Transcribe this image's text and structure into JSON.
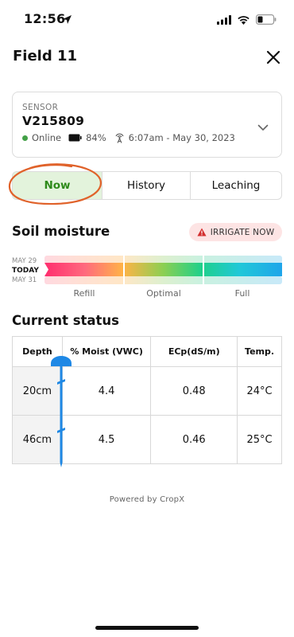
{
  "status_bar": {
    "time": "12:56"
  },
  "header": {
    "title": "Field 11"
  },
  "sensor": {
    "label": "SENSOR",
    "id": "V215809",
    "status": "Online",
    "status_color": "#43a047",
    "battery": "84%",
    "last_seen": "6:07am - May 30, 2023"
  },
  "tabs": [
    {
      "label": "Now",
      "active": true
    },
    {
      "label": "History",
      "active": false
    },
    {
      "label": "Leaching",
      "active": false
    }
  ],
  "soil_moisture": {
    "title": "Soil moisture",
    "alert": "IRRIGATE NOW",
    "alert_color": "#d32f2f",
    "dates": {
      "previous": "MAY 29",
      "current": "TODAY",
      "next": "MAY 31"
    },
    "zones": {
      "refill": "Refill",
      "optimal": "Optimal",
      "full": "Full"
    }
  },
  "current_status": {
    "title": "Current status",
    "columns": [
      "Depth",
      "% Moist (VWC)",
      "ECp(dS/m)",
      "Temp."
    ],
    "rows": [
      {
        "depth": "20cm",
        "moist": "4.4",
        "ecp": "0.48",
        "temp": "24°C"
      },
      {
        "depth": "46cm",
        "moist": "4.5",
        "ecp": "0.46",
        "temp": "25°C"
      }
    ]
  },
  "footer": {
    "text": "Powered by CropX"
  },
  "colors": {
    "accent_green": "#2e8a1a",
    "probe_blue": "#1e88e5",
    "highlight_orange": "#e0622a"
  }
}
